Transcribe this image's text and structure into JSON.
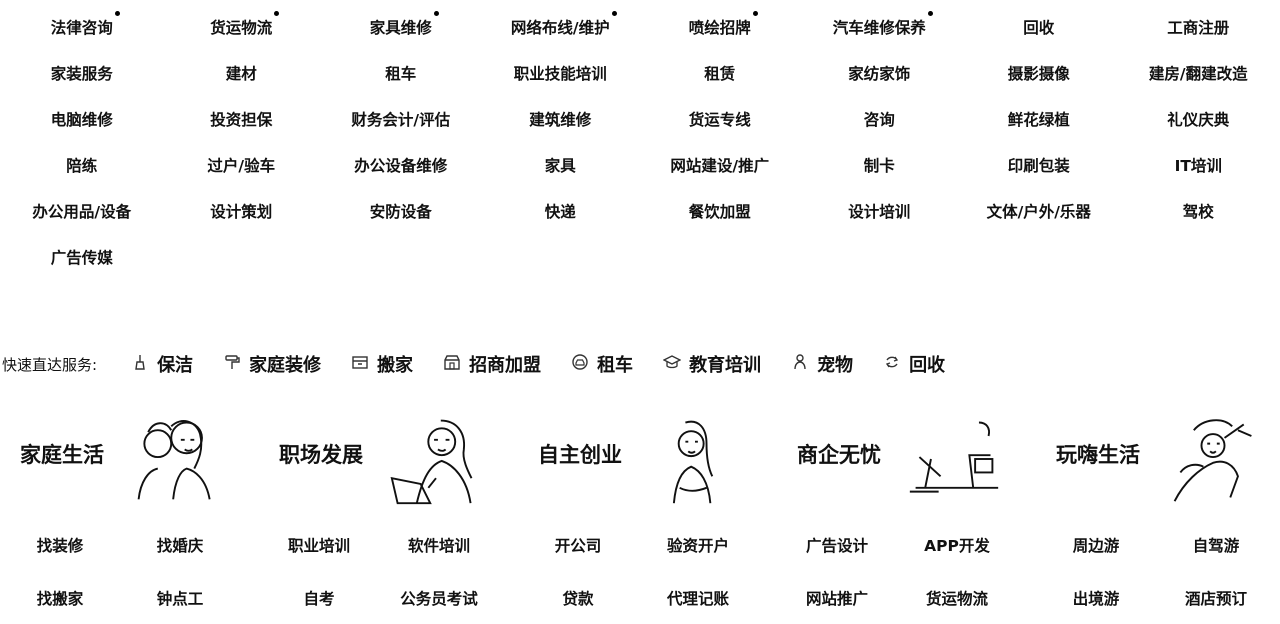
{
  "categories": [
    {
      "label": "法律咨询",
      "hot": true
    },
    {
      "label": "货运物流",
      "hot": true
    },
    {
      "label": "家具维修",
      "hot": true
    },
    {
      "label": "网络布线/维护",
      "hot": true
    },
    {
      "label": "喷绘招牌",
      "hot": true
    },
    {
      "label": "汽车维修保养",
      "hot": true
    },
    {
      "label": "回收",
      "hot": false
    },
    {
      "label": "工商注册",
      "hot": false
    },
    {
      "label": "家装服务",
      "hot": false
    },
    {
      "label": "建材",
      "hot": false
    },
    {
      "label": "租车",
      "hot": false
    },
    {
      "label": "职业技能培训",
      "hot": false
    },
    {
      "label": "租赁",
      "hot": false
    },
    {
      "label": "家纺家饰",
      "hot": false
    },
    {
      "label": "摄影摄像",
      "hot": false
    },
    {
      "label": "建房/翻建改造",
      "hot": false
    },
    {
      "label": "电脑维修",
      "hot": false
    },
    {
      "label": "投资担保",
      "hot": false
    },
    {
      "label": "财务会计/评估",
      "hot": false
    },
    {
      "label": "建筑维修",
      "hot": false
    },
    {
      "label": "货运专线",
      "hot": false
    },
    {
      "label": "咨询",
      "hot": false
    },
    {
      "label": "鲜花绿植",
      "hot": false
    },
    {
      "label": "礼仪庆典",
      "hot": false
    },
    {
      "label": "陪练",
      "hot": false
    },
    {
      "label": "过户/验车",
      "hot": false
    },
    {
      "label": "办公设备维修",
      "hot": false
    },
    {
      "label": "家具",
      "hot": false
    },
    {
      "label": "网站建设/推广",
      "hot": false
    },
    {
      "label": "制卡",
      "hot": false
    },
    {
      "label": "印刷包装",
      "hot": false
    },
    {
      "label": "IT培训",
      "hot": false
    },
    {
      "label": "办公用品/设备",
      "hot": false
    },
    {
      "label": "设计策划",
      "hot": false
    },
    {
      "label": "安防设备",
      "hot": false
    },
    {
      "label": "快递",
      "hot": false
    },
    {
      "label": "餐饮加盟",
      "hot": false
    },
    {
      "label": "设计培训",
      "hot": false
    },
    {
      "label": "文体/户外/乐器",
      "hot": false
    },
    {
      "label": "驾校",
      "hot": false
    },
    {
      "label": "广告传媒",
      "hot": false
    }
  ],
  "quick_services": {
    "label": "快速直达服务:",
    "items": [
      {
        "label": "保洁",
        "icon": "broom-icon"
      },
      {
        "label": "家庭装修",
        "icon": "paint-roller-icon"
      },
      {
        "label": "搬家",
        "icon": "moving-box-icon"
      },
      {
        "label": "招商加盟",
        "icon": "storefront-icon"
      },
      {
        "label": "租车",
        "icon": "car-icon"
      },
      {
        "label": "教育培训",
        "icon": "graduation-cap-icon"
      },
      {
        "label": "宠物",
        "icon": "pet-icon"
      },
      {
        "label": "回收",
        "icon": "recycle-icon"
      }
    ]
  },
  "features": [
    {
      "title": "家庭生活",
      "illustration": "family-illustration",
      "links": [
        "找装修",
        "找婚庆",
        "找搬家",
        "钟点工"
      ]
    },
    {
      "title": "职场发展",
      "illustration": "office-woman-illustration",
      "links": [
        "职业培训",
        "软件培训",
        "自考",
        "公务员考试"
      ]
    },
    {
      "title": "自主创业",
      "illustration": "businesswoman-illustration",
      "links": [
        "开公司",
        "验资开户",
        "贷款",
        "代理记账"
      ]
    },
    {
      "title": "商企无忧",
      "illustration": "office-desk-illustration",
      "links": [
        "广告设计",
        "APP开发",
        "网站推广",
        "货运物流"
      ]
    },
    {
      "title": "玩嗨生活",
      "illustration": "leisure-illustration",
      "links": [
        "周边游",
        "自驾游",
        "出境游",
        "酒店预订"
      ]
    }
  ]
}
